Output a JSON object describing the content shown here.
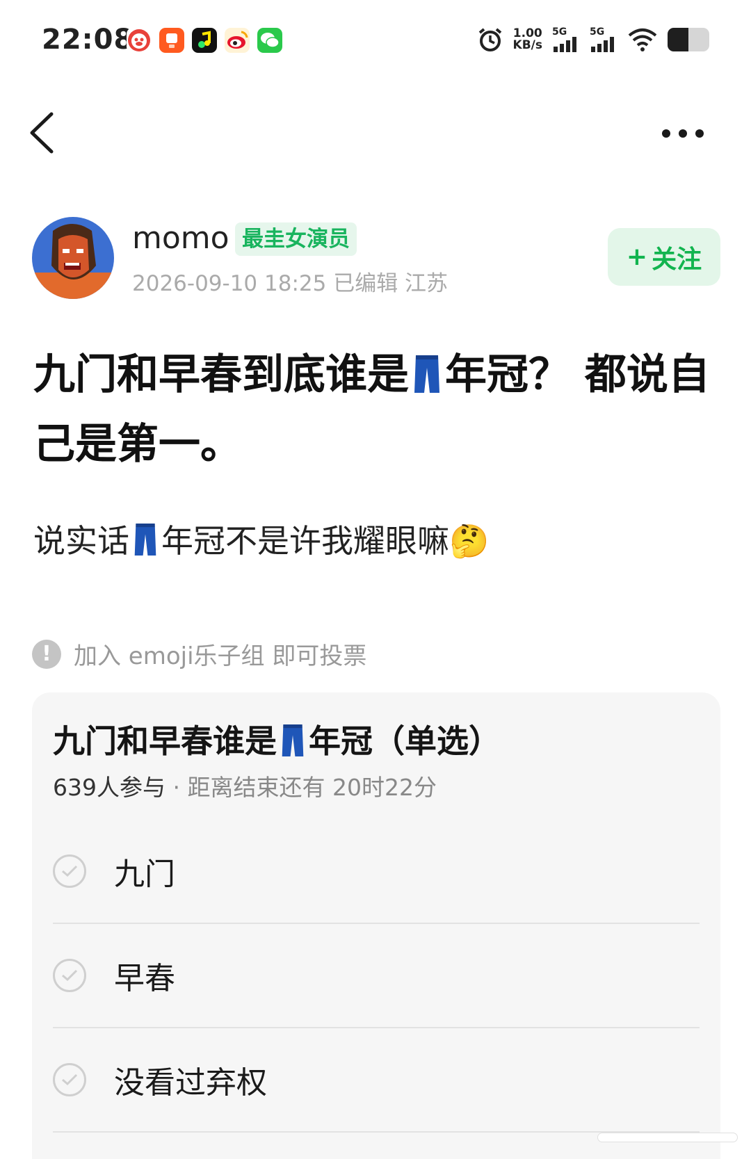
{
  "status_bar": {
    "time": "22:08",
    "net_speed_value": "1.00",
    "net_speed_unit": "KB/s",
    "sim1_label": "5G",
    "sim2_label": "5G",
    "battery_level": 0.5,
    "apps": [
      "pig-app-icon",
      "ai-app-icon",
      "music-app-icon",
      "weibo-icon",
      "wechat-icon"
    ]
  },
  "author": {
    "name": "momo",
    "badge": "最圭女演员",
    "meta": "2026-09-10 18:25  已编辑  江苏",
    "follow_label": "关注",
    "follow_plus": "+"
  },
  "post": {
    "title_part1": "九门和早春到底谁是",
    "title_part2": "年冠？ 都说自己是第一。",
    "body_part1": "说实话",
    "body_part2": "年冠不是许我耀眼嘛",
    "emoji_thinking": "🤔"
  },
  "vote_notice": {
    "icon": "!",
    "text": "加入 emoji乐子组 即可投票"
  },
  "poll": {
    "title_part1": "九门和早春谁是",
    "title_part2": "年冠（单选）",
    "participants": "639人参与",
    "separator": "·",
    "time_left": "距离结束还有 20时22分",
    "options": [
      {
        "label": "九门"
      },
      {
        "label": "早春"
      },
      {
        "label": "没看过弃权"
      }
    ]
  },
  "colors": {
    "accent_green": "#12b44f",
    "badge_bg": "#e6f6ec",
    "card_bg": "#f6f6f6"
  }
}
